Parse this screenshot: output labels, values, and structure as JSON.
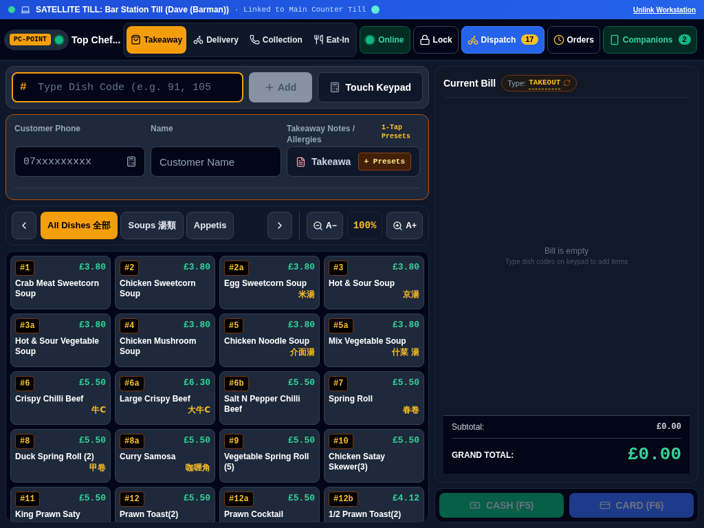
{
  "banner": {
    "connected": true,
    "title": "SATELLITE TILL: Bar Station Till (Dave (Barman))",
    "link_status": "· Linked to Main Counter Till",
    "unlink": "Unlink Workstation"
  },
  "topbar": {
    "badge": "PC-POINT",
    "terminal_online": true,
    "restaurant": "Top Chef...",
    "order_types": [
      {
        "kind": "takeaway",
        "label": "Takeaway",
        "selected": true
      },
      {
        "kind": "delivery",
        "label": "Delivery",
        "selected": false
      },
      {
        "kind": "collection",
        "label": "Collection",
        "selected": false
      },
      {
        "kind": "eatin",
        "label": "Eat-In",
        "selected": false
      }
    ],
    "actions": [
      {
        "kind": "online",
        "label": "Online"
      },
      {
        "kind": "lock",
        "label": "Lock"
      },
      {
        "kind": "dispatch",
        "label": "Dispatch",
        "count": "17"
      },
      {
        "kind": "orders",
        "label": "Orders"
      },
      {
        "kind": "companions",
        "label": "Companions",
        "count": "2"
      }
    ]
  },
  "dish_entry": {
    "prefix": "#",
    "placeholder": "Type Dish Code (e.g. 91, 105",
    "add": "Add",
    "add_disabled": true,
    "keypad": "Touch Keypad"
  },
  "customer": {
    "phone_label": "Customer Phone",
    "phone_placeholder": "07xxxxxxxxx",
    "name_label": "Name",
    "name_placeholder": "Customer Name",
    "notes_label": "Takeaway Notes / Allergies",
    "presets_hint": "1-Tap Presets",
    "notes_value": "Takeawa",
    "presets_button": "+ Presets"
  },
  "categories": [
    {
      "label": "All Dishes 全部",
      "selected": true
    },
    {
      "label": "Soups 湯類",
      "selected": false
    },
    {
      "label": "Appetis",
      "selected": false
    }
  ],
  "zoom": {
    "out": "A−",
    "level_text": "100%",
    "in": "A+"
  },
  "dishes": [
    {
      "code": "#1",
      "price": "£3.80",
      "name": "Crab Meat Sweetcorn Soup"
    },
    {
      "code": "#2",
      "price": "£3.80",
      "name": "Chicken Sweetcorn Soup"
    },
    {
      "code": "#2a",
      "price": "£3.80",
      "name": "Egg Sweetcorn Soup",
      "chinese": "米湯"
    },
    {
      "code": "#3",
      "price": "£3.80",
      "name": "Hot & Sour Soup",
      "chinese": "京湯"
    },
    {
      "code": "#3a",
      "price": "£3.80",
      "name": "Hot & Sour Vegetable Soup"
    },
    {
      "code": "#4",
      "price": "£3.80",
      "name": "Chicken Mushroom Soup"
    },
    {
      "code": "#5",
      "price": "£3.80",
      "name": "Chicken Noodle Soup",
      "chinese": "介面湯"
    },
    {
      "code": "#5a",
      "price": "£3.80",
      "name": "Mix Vegetable Soup",
      "chinese": "什菜 湯"
    },
    {
      "code": "#6",
      "price": "£5.50",
      "name": "Crispy Chilli Beef",
      "chinese": "牛C"
    },
    {
      "code": "#6a",
      "price": "£6.30",
      "name": "Large Crispy Beef",
      "chinese": "大牛C"
    },
    {
      "code": "#6b",
      "price": "£5.50",
      "name": "Salt N Pepper Chilli Beef"
    },
    {
      "code": "#7",
      "price": "£5.50",
      "name": "Spring Roll",
      "chinese": "春卷"
    },
    {
      "code": "#8",
      "price": "£5.50",
      "name": "Duck Spring Roll (2)",
      "chinese": "甲卷"
    },
    {
      "code": "#8a",
      "price": "£5.50",
      "name": "Curry Samosa",
      "chinese": "咖喱角"
    },
    {
      "code": "#9",
      "price": "£5.50",
      "name": "Vegetable Spring Roll (5)"
    },
    {
      "code": "#10",
      "price": "£5.50",
      "name": "Chicken Satay Skewer(3)"
    },
    {
      "code": "#11",
      "price": "£5.50",
      "name": "King Prawn Saty"
    },
    {
      "code": "#12",
      "price": "£5.50",
      "name": "Prawn Toast(2)"
    },
    {
      "code": "#12a",
      "price": "£5.50",
      "name": "Prawn Cocktail"
    },
    {
      "code": "#12b",
      "price": "£4.12",
      "name": "1/2 Prawn Toast(2)"
    }
  ],
  "bill": {
    "title": "Current Bill",
    "type_label": "Type:",
    "type_value": "TAKEOUT",
    "empty_title": "Bill is empty",
    "empty_hint": "Type dish codes on keypad to add items",
    "subtotal_label": "Subtotal:",
    "subtotal": "£0.00",
    "total_label": "GRAND TOTAL:",
    "total": "£0.00"
  },
  "payment": [
    {
      "kind": "cash",
      "label": "CASH (F5)",
      "disabled": true
    },
    {
      "kind": "card",
      "label": "CARD (F6)",
      "disabled": true
    }
  ]
}
